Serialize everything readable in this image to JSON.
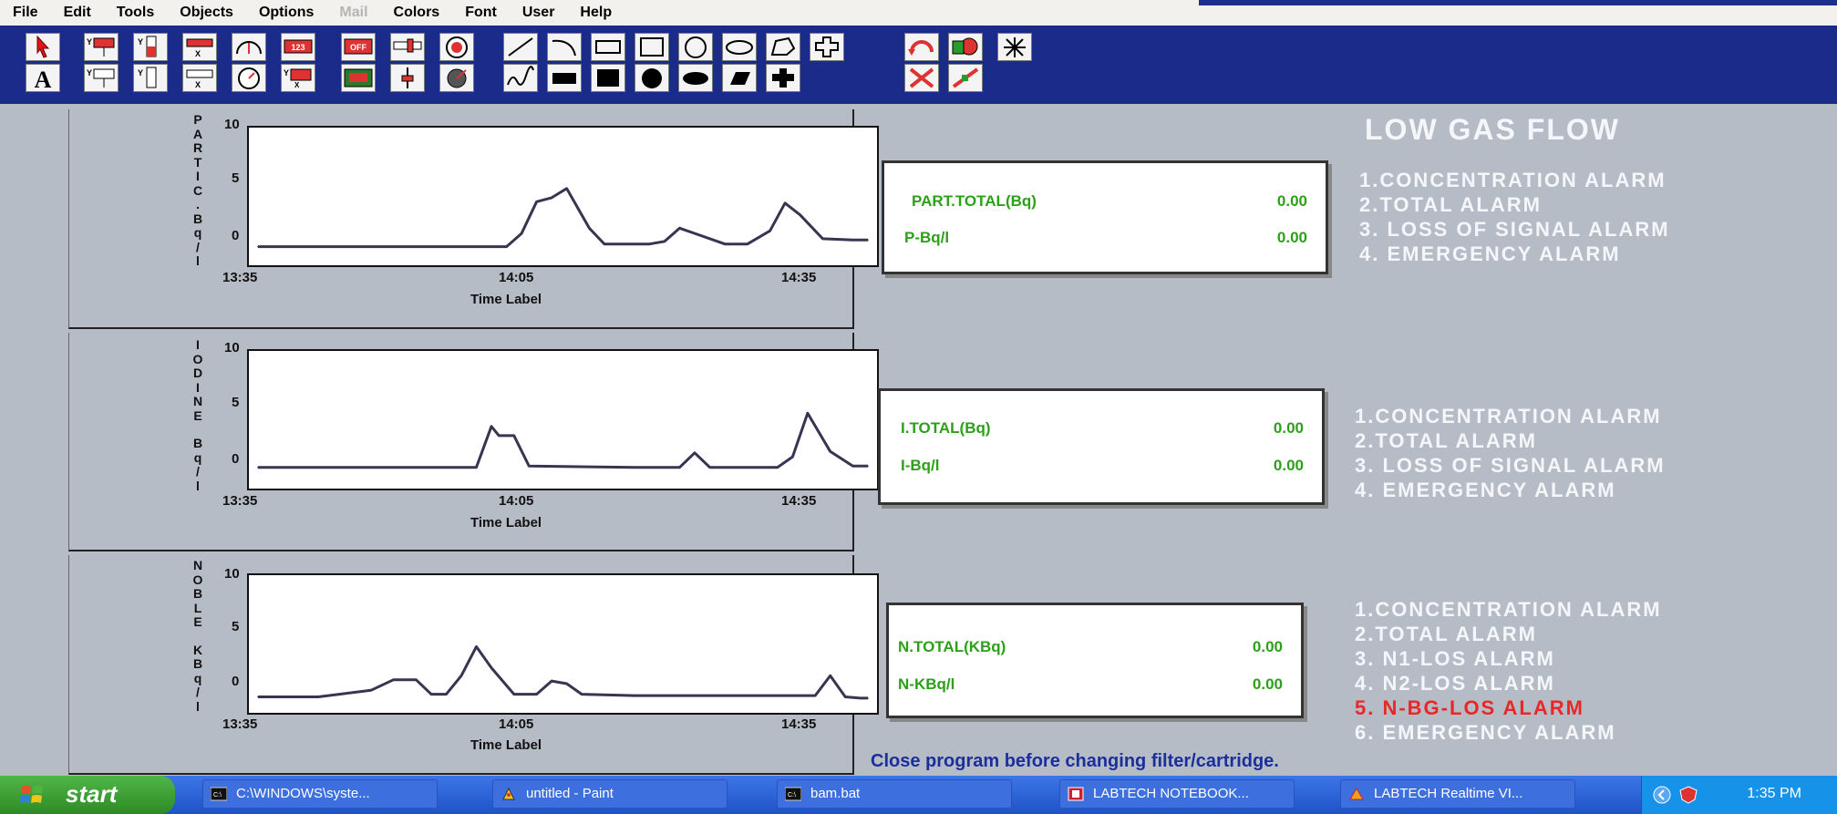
{
  "menu": [
    "File",
    "Edit",
    "Tools",
    "Objects",
    "Options",
    "Mail",
    "Colors",
    "Font",
    "User",
    "Help"
  ],
  "menu_disabled": [
    "Mail"
  ],
  "toolbar_tools": [
    "pointer-tool",
    "text-tool",
    "y-meter-tool",
    "y-bar-tool",
    "x-slider-tool",
    "y-slider-tool",
    "gauge-tool",
    "dial-tool",
    "digital-display-tool",
    "y-meter-tool-2",
    "off-switch-tool",
    "led-display-tool",
    "bar-switch-tool",
    "slider-tool",
    "rotary-knob-tool",
    "knob-tool",
    "line-tool",
    "freehand-tool",
    "curve-tool",
    "zigzag-tool",
    "rectangle-tool",
    "filled-rect-tool",
    "box-tool",
    "filled-box-tool",
    "circle-tool",
    "filled-circle-tool",
    "ellipse-tool",
    "filled-ellipse-tool",
    "polygon-tool",
    "filled-polygon-tool",
    "shape-tool",
    "filled-shape-tool",
    "rotate-tool",
    "scale-tool",
    "color-fill-tool",
    "connect-tool",
    "sparkle-tool"
  ],
  "charts": [
    {
      "ylabel": "PARTIC.Bq/l",
      "ylabel_chars": [
        "P",
        "A",
        "R",
        "T",
        "I",
        "C",
        ".",
        "B",
        "q",
        "/",
        "l"
      ],
      "yticks": [
        "10",
        "5",
        "0"
      ],
      "xticks": [
        "13:35",
        "14:05",
        "14:35"
      ],
      "xlabel": "Time Label"
    },
    {
      "ylabel": "IODINE Bq/l",
      "ylabel_chars": [
        "I",
        "O",
        "D",
        "I",
        "N",
        "E",
        "",
        "B",
        "q",
        "/",
        "l"
      ],
      "yticks": [
        "10",
        "5",
        "0"
      ],
      "xticks": [
        "13:35",
        "14:05",
        "14:35"
      ],
      "xlabel": "Time Label"
    },
    {
      "ylabel": "NOBLE KBq/l",
      "ylabel_chars": [
        "N",
        "O",
        "B",
        "L",
        "E",
        "",
        "K",
        "B",
        "q",
        "/",
        "l"
      ],
      "yticks": [
        "10",
        "5",
        "0"
      ],
      "xticks": [
        "13:35",
        "14:05",
        "14:35"
      ],
      "xlabel": "Time Label"
    }
  ],
  "chart_data": [
    {
      "type": "line",
      "title": "",
      "xlabel": "Time Label",
      "ylabel": "PARTIC.Bq/l",
      "ylim": [
        0,
        10
      ],
      "xlim_minutes_label": [
        "13:35",
        "14:35"
      ],
      "series": [
        {
          "x": [
            0,
            10,
            20,
            33,
            35,
            37,
            39,
            41,
            44,
            46,
            52,
            54,
            56,
            62,
            65,
            68,
            70,
            72,
            75,
            79,
            81
          ],
          "y": [
            1.2,
            1.2,
            1.2,
            1.2,
            2.2,
            4.6,
            4.9,
            5.6,
            2.6,
            1.4,
            1.4,
            1.6,
            2.6,
            1.4,
            1.4,
            2.4,
            4.5,
            3.6,
            1.8,
            1.7,
            1.7
          ]
        }
      ]
    },
    {
      "type": "line",
      "title": "",
      "xlabel": "Time Label",
      "ylabel": "IODINE Bq/l",
      "ylim": [
        0,
        10
      ],
      "xlim_minutes_label": [
        "13:35",
        "14:35"
      ],
      "series": [
        {
          "x": [
            0,
            10,
            20,
            27,
            29,
            31,
            32,
            34,
            36,
            50,
            56,
            58,
            60,
            69,
            71,
            73,
            76,
            79,
            81
          ],
          "y": [
            1.4,
            1.4,
            1.4,
            1.4,
            1.4,
            4.5,
            3.8,
            3.8,
            1.5,
            1.4,
            1.4,
            2.5,
            1.4,
            1.4,
            2.2,
            5.5,
            2.6,
            1.5,
            1.5
          ]
        }
      ]
    },
    {
      "type": "line",
      "title": "",
      "xlabel": "Time Label",
      "ylabel": "NOBLE KBq/l",
      "ylim": [
        0,
        10
      ],
      "xlim_minutes_label": [
        "13:35",
        "14:35"
      ],
      "series": [
        {
          "x": [
            0,
            8,
            15,
            18,
            21,
            23,
            25,
            27,
            29,
            31,
            34,
            37,
            39,
            41,
            43,
            50,
            60,
            70,
            74,
            76,
            78,
            80,
            81
          ],
          "y": [
            1.0,
            1.0,
            1.5,
            2.3,
            2.3,
            1.2,
            1.2,
            2.6,
            4.8,
            3.2,
            1.2,
            1.2,
            2.2,
            2.0,
            1.2,
            1.1,
            1.1,
            1.1,
            1.1,
            2.6,
            1.0,
            0.9,
            0.9
          ]
        }
      ]
    }
  ],
  "readouts": [
    {
      "label1": "PART.TOTAL(Bq)",
      "value1": "0.00",
      "label2": "P-Bq/l",
      "value2": "0.00"
    },
    {
      "label1": "I.TOTAL(Bq)",
      "value1": "0.00",
      "label2": "I-Bq/l",
      "value2": "0.00"
    },
    {
      "label1": "N.TOTAL(KBq)",
      "value1": "0.00",
      "label2": "N-KBq/l",
      "value2": "0.00"
    }
  ],
  "low_gas_flow": "LOW GAS FLOW",
  "alarms_particulate": [
    "1.CONCENTRATION ALARM",
    "2.TOTAL ALARM",
    "3. LOSS OF SIGNAL ALARM",
    "4. EMERGENCY ALARM"
  ],
  "alarms_iodine": [
    "1.CONCENTRATION ALARM",
    "2.TOTAL ALARM",
    "3. LOSS OF SIGNAL ALARM",
    "4. EMERGENCY ALARM"
  ],
  "alarms_noble": [
    "1.CONCENTRATION ALARM",
    "2.TOTAL ALARM",
    "3. N1-LOS ALARM",
    "4. N2-LOS ALARM",
    "5. N-BG-LOS ALARM",
    "6. EMERGENCY ALARM"
  ],
  "alarms_noble_active_index": 4,
  "close_message": "Close program before changing filter/cartridge.",
  "taskbar": {
    "start": "start",
    "tasks": [
      "C:\\WINDOWS\\syste...",
      "untitled - Paint",
      "bam.bat",
      "LABTECH NOTEBOOK...",
      "LABTECH Realtime VI..."
    ],
    "clock": "1:35 PM"
  },
  "colors": {
    "toolbar": "#1b2b8a",
    "background": "#b6bcc6",
    "readout_text": "#2da01a",
    "alarm_text": "#f4f6fa",
    "alarm_active": "#e82828",
    "plot_line": "#3a3450"
  }
}
